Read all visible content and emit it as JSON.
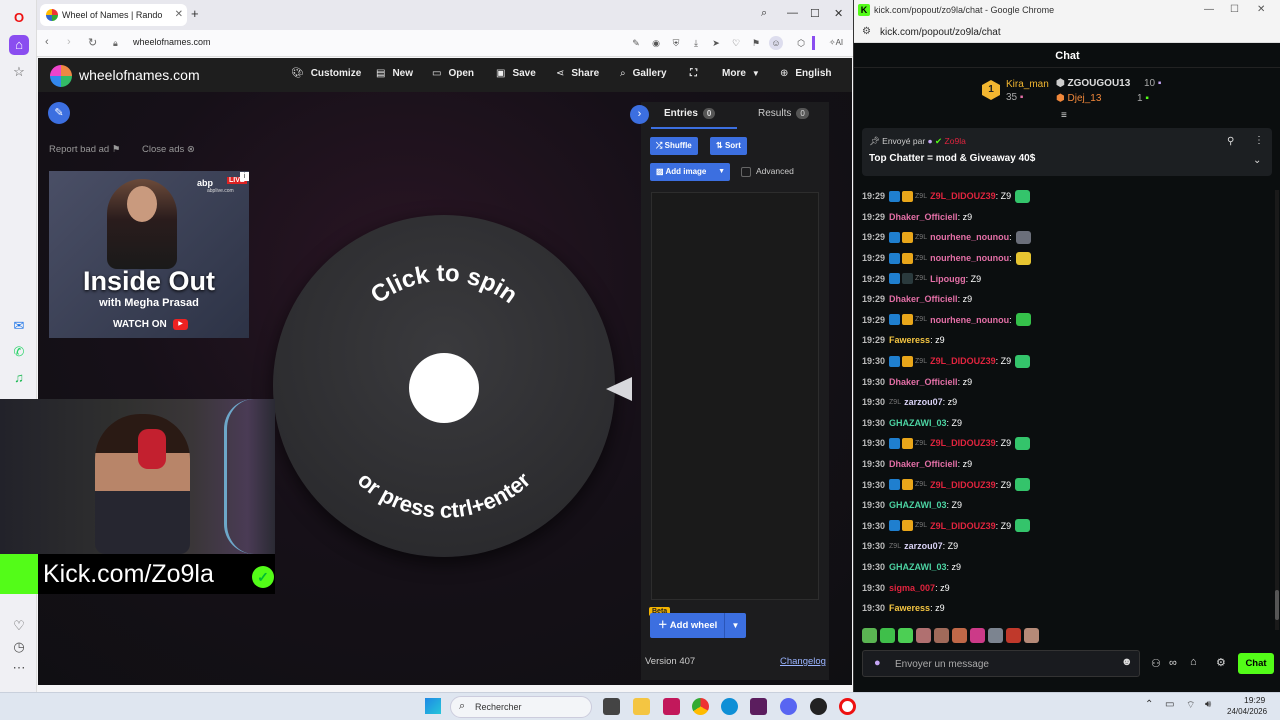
{
  "opera": {
    "tab_title": "Wheel of Names | Rando",
    "url": "wheelofnames.com",
    "ai_label": "AI"
  },
  "won": {
    "site_title": "wheelofnames.com",
    "nav": [
      "Customize",
      "New",
      "Open",
      "Save",
      "Share",
      "Gallery",
      "More",
      "English"
    ],
    "report_ad": "Report bad ad",
    "close_ads": "Close ads",
    "ad": {
      "brand": "abp",
      "live": "LIVE",
      "site": "abplive.com",
      "title": "Inside Out",
      "subtitle": "with Megha Prasad",
      "watch": "WATCH ON"
    },
    "wheel": {
      "top_text": "Click to spin",
      "bottom_text": "or press ctrl+enter"
    },
    "panel": {
      "entries_label": "Entries",
      "entries_count": "0",
      "results_label": "Results",
      "results_count": "0",
      "shuffle": "Shuffle",
      "sort": "Sort",
      "add_image": "Add image",
      "advanced": "Advanced",
      "beta": "Beta",
      "add_wheel": "Add wheel",
      "version": "Version 407",
      "changelog": "Changelog"
    }
  },
  "stream_overlay": {
    "channel": "Kick.com/Zo9la"
  },
  "chat": {
    "window_title": "kick.com/popout/zo9la/chat - Google Chrome",
    "url": "kick.com/popout/zo9la/chat",
    "header": "Chat",
    "leaderboard": [
      {
        "rank": "1",
        "name": "Kira_man",
        "count": "35"
      },
      {
        "rank": "",
        "name": "ZGOUGOU13",
        "count": "10"
      },
      {
        "rank": "",
        "name": "Djej_13",
        "count": "1"
      }
    ],
    "pinned": {
      "by_label": "Envoyé par",
      "by_user": "Zo9la",
      "message": "Top Chatter = mod & Giveaway 40$"
    },
    "messages": [
      {
        "ts": "19:29",
        "badges": [
          "vip",
          "crown"
        ],
        "tag": "Z9L",
        "user": "Z9L_DIDOUZ39",
        "color": "#e0243e",
        "text": ": Z9",
        "emote": "#34c46b"
      },
      {
        "ts": "19:29",
        "badges": [],
        "tag": "",
        "user": "Dhaker_Officiell",
        "color": "#e36fa6",
        "text": ": z9",
        "emote": ""
      },
      {
        "ts": "19:29",
        "badges": [
          "vip",
          "crown"
        ],
        "tag": "Z9L",
        "user": "nourhene_nounou",
        "color": "#e36fa6",
        "text": ":",
        "emote": "#6b6f7a"
      },
      {
        "ts": "19:29",
        "badges": [
          "vip",
          "crown"
        ],
        "tag": "Z9L",
        "user": "nourhene_nounou",
        "color": "#e36fa6",
        "text": ":",
        "emote": "#e7c531"
      },
      {
        "ts": "19:29",
        "badges": [
          "vip",
          "sub"
        ],
        "tag": "Z9L",
        "user": "Lipougg",
        "color": "#e36fa6",
        "text": ": Z9",
        "emote": ""
      },
      {
        "ts": "19:29",
        "badges": [],
        "tag": "",
        "user": "Dhaker_Officiell",
        "color": "#e36fa6",
        "text": ": z9",
        "emote": ""
      },
      {
        "ts": "19:29",
        "badges": [
          "vip",
          "crown"
        ],
        "tag": "Z9L",
        "user": "nourhene_nounou",
        "color": "#e36fa6",
        "text": ":",
        "emote": "#35c14a"
      },
      {
        "ts": "19:29",
        "badges": [],
        "tag": "",
        "user": "Faweress",
        "color": "#f4c542",
        "text": ": z9",
        "emote": ""
      },
      {
        "ts": "19:30",
        "badges": [
          "vip",
          "crown"
        ],
        "tag": "Z9L",
        "user": "Z9L_DIDOUZ39",
        "color": "#e0243e",
        "text": ": Z9",
        "emote": "#34c46b"
      },
      {
        "ts": "19:30",
        "badges": [],
        "tag": "",
        "user": "Dhaker_Officiell",
        "color": "#e36fa6",
        "text": ": z9",
        "emote": ""
      },
      {
        "ts": "19:30",
        "badges": [],
        "tag": "Z9L",
        "user": "zarzou07",
        "color": "#d9d2f5",
        "text": ": z9",
        "emote": ""
      },
      {
        "ts": "19:30",
        "badges": [],
        "tag": "",
        "user": "GHAZAWI_03",
        "color": "#4cd3a2",
        "text": ": Z9",
        "emote": ""
      },
      {
        "ts": "19:30",
        "badges": [
          "vip",
          "crown"
        ],
        "tag": "Z9L",
        "user": "Z9L_DIDOUZ39",
        "color": "#e0243e",
        "text": ": Z9",
        "emote": "#34c46b"
      },
      {
        "ts": "19:30",
        "badges": [],
        "tag": "",
        "user": "Dhaker_Officiell",
        "color": "#e36fa6",
        "text": ": z9",
        "emote": ""
      },
      {
        "ts": "19:30",
        "badges": [
          "vip",
          "crown"
        ],
        "tag": "Z9L",
        "user": "Z9L_DIDOUZ39",
        "color": "#e0243e",
        "text": ": Z9",
        "emote": "#34c46b"
      },
      {
        "ts": "19:30",
        "badges": [],
        "tag": "",
        "user": "GHAZAWI_03",
        "color": "#4cd3a2",
        "text": ": Z9",
        "emote": ""
      },
      {
        "ts": "19:30",
        "badges": [
          "vip",
          "crown"
        ],
        "tag": "Z9L",
        "user": "Z9L_DIDOUZ39",
        "color": "#e0243e",
        "text": ": Z9",
        "emote": "#34c46b"
      },
      {
        "ts": "19:30",
        "badges": [],
        "tag": "Z9L",
        "user": "zarzou07",
        "color": "#d9d2f5",
        "text": ": Z9",
        "emote": ""
      },
      {
        "ts": "19:30",
        "badges": [],
        "tag": "",
        "user": "GHAZAWI_03",
        "color": "#4cd3a2",
        "text": ": z9",
        "emote": ""
      },
      {
        "ts": "19:30",
        "badges": [],
        "tag": "",
        "user": "sigma_007",
        "color": "#e0243e",
        "text": ": z9",
        "emote": ""
      },
      {
        "ts": "19:30",
        "badges": [],
        "tag": "",
        "user": "Faweress",
        "color": "#f4c542",
        "text": ": z9",
        "emote": ""
      }
    ],
    "emotes": [
      "#5ab552",
      "#3fbf4a",
      "#4ccf54",
      "#b07070",
      "#a06a5a",
      "#c06848",
      "#cc3a88",
      "#7c8490",
      "#c0392b",
      "#b58a78"
    ],
    "input_placeholder": "Envoyer un message",
    "send_label": "Chat"
  },
  "taskbar": {
    "search_label": "Rechercher",
    "time": "19:29",
    "date": "24/04/2026"
  },
  "colors": {
    "accent_blue": "#3c6fe0",
    "kick_green": "#53fc18"
  }
}
